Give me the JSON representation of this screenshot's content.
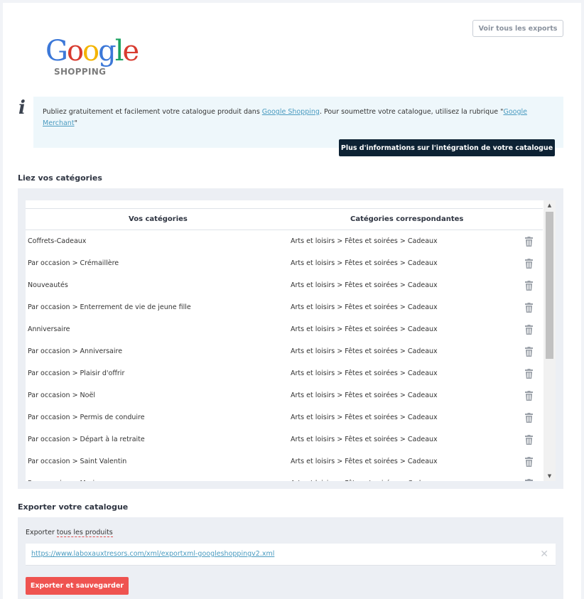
{
  "header": {
    "export_all_label": "Voir tous les exports",
    "logo": {
      "brand_letters": [
        "G",
        "o",
        "o",
        "g",
        "l",
        "e"
      ],
      "brand_colors": [
        "#3c78d8",
        "#d83b2f",
        "#f4b400",
        "#3c78d8",
        "#1aa260",
        "#d83b2f"
      ],
      "sub": "SHOPPING"
    }
  },
  "info": {
    "icon": "info-icon",
    "text_before": "Publiez gratuitement et facilement votre catalogue produit dans ",
    "link1": "Google Shopping",
    "text_middle": ". Pour soumettre votre catalogue, utilisez la rubrique \"",
    "link2": "Google Merchant",
    "text_after": "\"",
    "button_label": "Plus d'informations sur l'intégration de votre catalogue"
  },
  "categories": {
    "title": "Liez vos catégories",
    "col_yours": "Vos catégories",
    "col_match": "Catégories correspondantes",
    "rows": [
      {
        "yours": "Coffrets-Cadeaux",
        "match": "Arts et loisirs > Fêtes et soirées > Cadeaux"
      },
      {
        "yours": "Par occasion > Crémaillère",
        "match": "Arts et loisirs > Fêtes et soirées > Cadeaux"
      },
      {
        "yours": "Nouveautés",
        "match": "Arts et loisirs > Fêtes et soirées > Cadeaux"
      },
      {
        "yours": "Par occasion > Enterrement de vie de jeune fille",
        "match": "Arts et loisirs > Fêtes et soirées > Cadeaux"
      },
      {
        "yours": "Anniversaire",
        "match": "Arts et loisirs > Fêtes et soirées > Cadeaux"
      },
      {
        "yours": "Par occasion > Anniversaire",
        "match": "Arts et loisirs > Fêtes et soirées > Cadeaux"
      },
      {
        "yours": "Par occasion > Plaisir d'offrir",
        "match": "Arts et loisirs > Fêtes et soirées > Cadeaux"
      },
      {
        "yours": "Par occasion > Noël",
        "match": "Arts et loisirs > Fêtes et soirées > Cadeaux"
      },
      {
        "yours": "Par occasion > Permis de conduire",
        "match": "Arts et loisirs > Fêtes et soirées > Cadeaux"
      },
      {
        "yours": "Par occasion > Départ à la retraite",
        "match": "Arts et loisirs > Fêtes et soirées > Cadeaux"
      },
      {
        "yours": "Par occasion > Saint Valentin",
        "match": "Arts et loisirs > Fêtes et soirées > Cadeaux"
      },
      {
        "yours": "Par occasion > Mariage",
        "match": "Arts et loisirs > Fêtes et soirées > Cadeaux"
      }
    ],
    "delete_icon": "trash-icon"
  },
  "export": {
    "title": "Exporter votre catalogue",
    "label_prefix": "Exporter ",
    "label_link": "tous les produits",
    "url": "https://www.laboxauxtresors.com/xml/exportxml-googleshoppingv2.xml",
    "clear_icon": "close-icon",
    "save_label": "Exporter et sauvegarder"
  }
}
